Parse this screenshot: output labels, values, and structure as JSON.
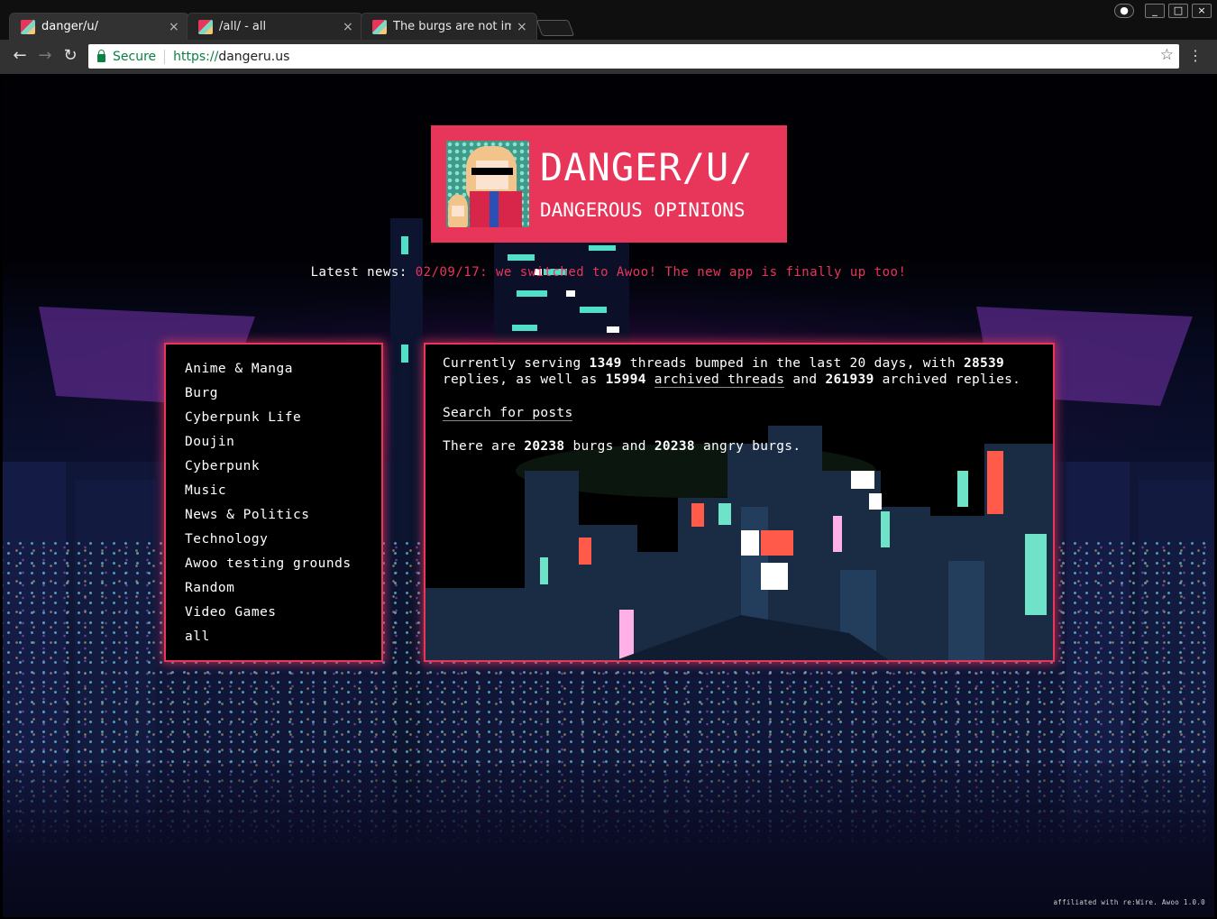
{
  "browser": {
    "tabs": [
      {
        "title": "danger/u/",
        "active": true
      },
      {
        "title": "/all/ - all",
        "active": false
      },
      {
        "title": "The burgs are not im",
        "active": false
      }
    ],
    "close_glyph": "×",
    "window_controls": {
      "profile_icon": "profile-icon",
      "minimize": "_",
      "maximize": "□",
      "close": "×"
    },
    "nav": {
      "back": "←",
      "forward": "→",
      "reload": "↻"
    },
    "address": {
      "security": "Secure",
      "scheme": "https://",
      "host": "dangeru.us"
    },
    "star": "☆",
    "menu": "⋮"
  },
  "logo": {
    "title": "DANGER/U/",
    "subtitle": "DANGEROUS OPINIONS"
  },
  "news": {
    "label": "Latest news:",
    "item": "02/09/17: we switched to Awoo! The new app is finally up too!"
  },
  "boards": [
    "Anime & Manga",
    "Burg",
    "Cyberpunk Life",
    "Doujin",
    "Cyberpunk",
    "Music",
    "News & Politics",
    "Technology",
    "Awoo testing grounds",
    "Random",
    "Video Games",
    "all"
  ],
  "stats": {
    "currently_serving": "Currently serving",
    "threads_count": "1349",
    "threads_bumped": "threads bumped in the last 20 days, with",
    "replies_count": "28539",
    "replies_as_well_as": "replies, as well as",
    "archived_threads_count": "15994",
    "archived_threads_link": "archived threads",
    "and": "and",
    "archived_replies_count": "261939",
    "archived_replies": "archived replies.",
    "search_link": "Search for posts",
    "there_are": "There are",
    "burgs_count": "20238",
    "burgs_and": "burgs and",
    "angry_count": "20238",
    "angry_burgs": "angry burgs."
  },
  "footer": "affiliated with re:Wire. Awoo 1.0.0",
  "colors": {
    "accent": "#e8365a",
    "background": "#000000",
    "text": "#ffffff"
  }
}
